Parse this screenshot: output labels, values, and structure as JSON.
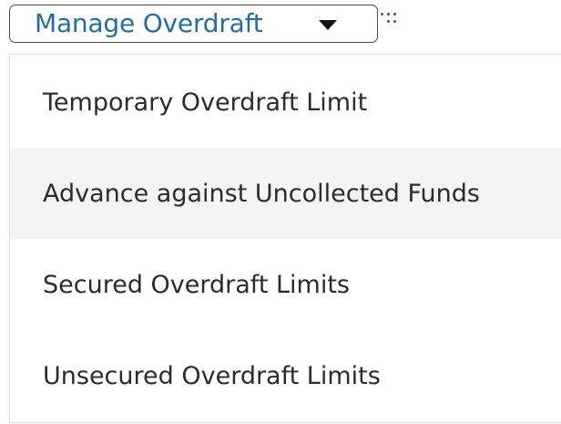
{
  "dropdown": {
    "label": "Manage Overdraft",
    "caret_icon": "caret-down-icon",
    "drag_icon": "drag-handle-icon",
    "label_color": "#1f6fa2"
  },
  "menu": {
    "items": [
      {
        "label": "Temporary Overdraft Limit"
      },
      {
        "label": "Advance against Uncollected Funds",
        "highlighted": true
      },
      {
        "label": "Secured Overdraft Limits"
      },
      {
        "label": "Unsecured Overdraft Limits"
      }
    ],
    "highlight_color": "#f4f4f4"
  }
}
